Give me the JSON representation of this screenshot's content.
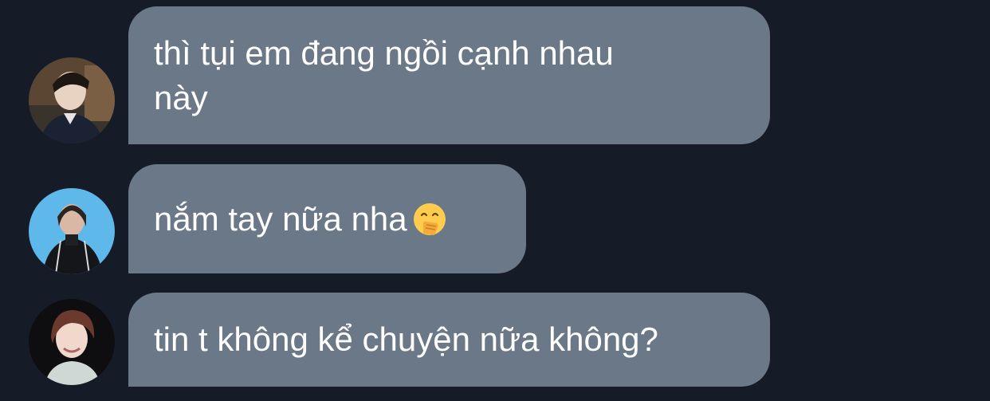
{
  "messages": [
    {
      "text": "thì tụi em đang ngồi cạnh nhau\nnày",
      "avatar_icon": "user-avatar-1",
      "avatar_bg": "#2d2a27"
    },
    {
      "text": "nắm tay nữa nha",
      "emoji_icon": "hand-over-mouth-emoji-icon",
      "avatar_icon": "user-avatar-2",
      "avatar_bg": "#5fb8ea"
    },
    {
      "text": "tin t không kể chuyện nữa không?",
      "avatar_icon": "user-avatar-3",
      "avatar_bg": "#0e0e10"
    }
  ],
  "colors": {
    "background": "#161c27",
    "bubble": "#6a7888",
    "text": "#ffffff"
  }
}
